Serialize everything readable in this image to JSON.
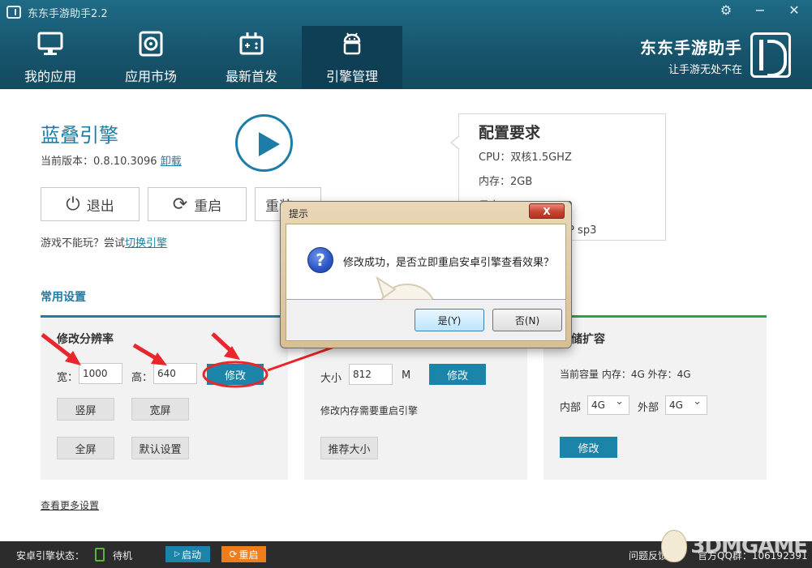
{
  "window": {
    "title": "东东手游助手2.2",
    "controls": [
      "settings-icon",
      "minimize-icon",
      "close-icon"
    ]
  },
  "nav": [
    {
      "label": "我的应用",
      "icon": "monitor-icon",
      "active": false
    },
    {
      "label": "应用市场",
      "icon": "store-icon",
      "active": false
    },
    {
      "label": "最新首发",
      "icon": "gamepad-icon",
      "active": false
    },
    {
      "label": "引擎管理",
      "icon": "android-icon",
      "active": true
    }
  ],
  "brand": {
    "name": "东东手游助手",
    "slogan": "让手游无处不在"
  },
  "engine": {
    "title": "蓝叠引擎",
    "version_prefix": "当前版本：0.8.10.3096",
    "uninstall": "卸载",
    "exit": "退出",
    "restart": "重启",
    "reinstall": "重装",
    "tip_prefix": "游戏不能玩？尝试",
    "switch_link": "切换引擎"
  },
  "config": {
    "title": "配置要求",
    "lines": [
      "CPU：双核1.5GHZ",
      "内存：2GB",
      "显卡：OpenGL 2.0",
      "系统：Windows XP sp3"
    ]
  },
  "settings": {
    "label": "常用设置",
    "resolution": {
      "title": "修改分辨率",
      "width_label": "宽：",
      "width_value": "1000",
      "height_label": "高：",
      "height_value": "640",
      "modify": "修改",
      "portrait": "竖屏",
      "landscape": "宽屏",
      "fullscreen": "全屏",
      "default": "默认设置"
    },
    "memory": {
      "size_label": "大小",
      "size_value": "812",
      "unit": "M",
      "modify": "修改",
      "note": "修改内存需要重启引擎",
      "recommend": "推荐大小"
    },
    "storage": {
      "title": "存储扩容",
      "current": "当前容量 内存：4G 外存：4G",
      "internal_label": "内部",
      "internal_value": "4G",
      "external_label": "外部",
      "external_value": "4G",
      "modify": "修改"
    },
    "more": "查看更多设置"
  },
  "dialog": {
    "title": "提示",
    "close": "X",
    "message": "修改成功，是否立即重启安卓引擎查看效果？",
    "yes": "是(Y)",
    "no": "否(N)"
  },
  "status": {
    "label": "安卓引擎状态：",
    "state": "待机",
    "start": "启动",
    "restart": "重启",
    "feedback": "问题反馈",
    "official": "官方QQ群：106192391"
  },
  "watermark": "3DMGAME",
  "colors": {
    "header": "#17546c",
    "accent": "#1e7da6",
    "storage_accent": "#2aa34a",
    "annotation": "#e8262b"
  }
}
